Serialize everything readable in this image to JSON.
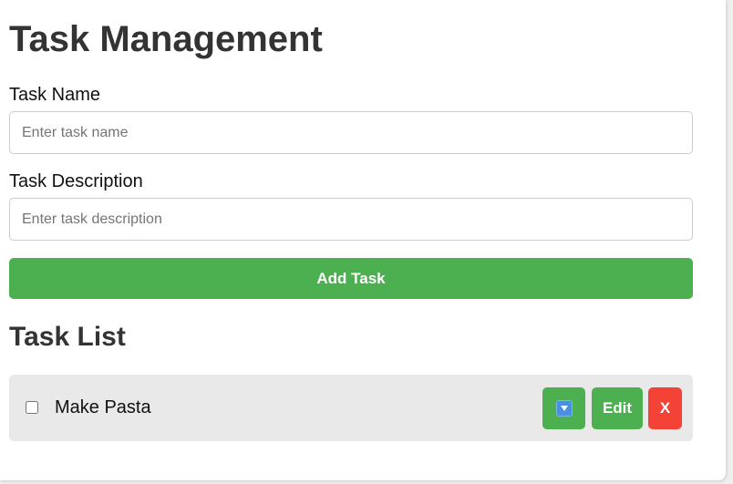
{
  "header": {
    "title": "Task Management"
  },
  "form": {
    "task_name_label": "Task Name",
    "task_name_placeholder": "Enter task name",
    "task_name_value": "",
    "task_description_label": "Task Description",
    "task_description_placeholder": "Enter task description",
    "task_description_value": "",
    "add_button_label": "Add Task"
  },
  "task_list": {
    "title": "Task List",
    "items": [
      {
        "name": "Make Pasta",
        "completed": false,
        "expand_icon": "down-arrow-icon",
        "edit_label": "Edit",
        "delete_label": "X"
      }
    ]
  },
  "colors": {
    "primary": "#4caf50",
    "danger": "#f44336",
    "item_background": "#e9e9e9",
    "heading_text": "#333333"
  }
}
